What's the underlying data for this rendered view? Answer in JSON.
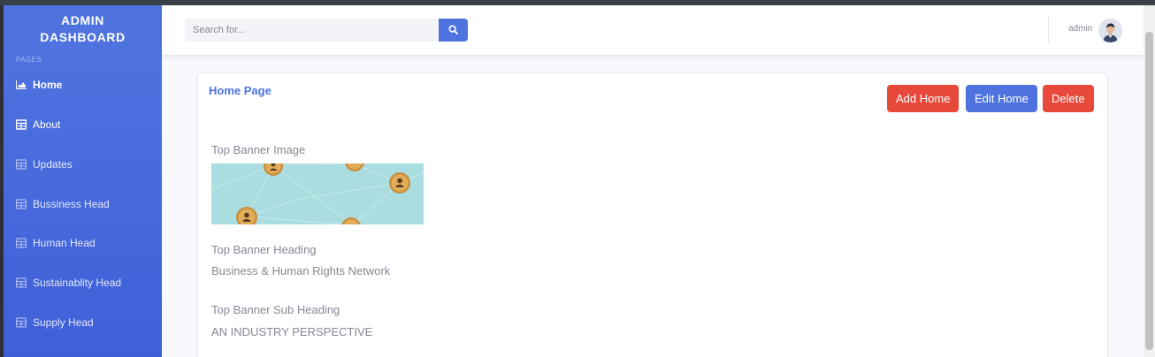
{
  "sidebar": {
    "brand_line1": "ADMIN",
    "brand_line2": "DASHBOARD",
    "section_label": "PAGES",
    "items": [
      {
        "label": "Home",
        "icon": "chart-area-icon"
      },
      {
        "label": "About",
        "icon": "table-icon"
      },
      {
        "label": "Updates",
        "icon": "table-icon"
      },
      {
        "label": "Bussiness Head",
        "icon": "table-icon"
      },
      {
        "label": "Human Head",
        "icon": "table-icon"
      },
      {
        "label": "Sustainablity Head",
        "icon": "table-icon"
      },
      {
        "label": "Supply Head",
        "icon": "table-icon"
      }
    ]
  },
  "topbar": {
    "search_placeholder": "Search for...",
    "search_icon": "search-icon",
    "user_name": "admin"
  },
  "card": {
    "title": "Home Page",
    "buttons": {
      "add": "Add Home",
      "edit": "Edit Home",
      "delete": "Delete"
    },
    "fields": {
      "banner_image_label": "Top Banner Image",
      "heading_label": "Top Banner Heading",
      "heading_value": "Business & Human Rights Network",
      "subheading_label": "Top Banner Sub Heading",
      "subheading_value": "AN INDUSTRY PERSPECTIVE"
    }
  },
  "colors": {
    "primary": "#4e73df",
    "danger": "#e74a3b",
    "text_muted": "#858796"
  }
}
